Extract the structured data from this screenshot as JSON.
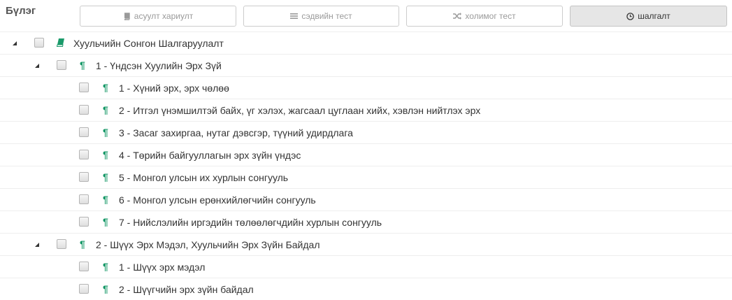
{
  "panel": {
    "title": "Бүлэг"
  },
  "modes": [
    {
      "label": "асуулт хариулт",
      "icon": "book-icon",
      "active": false
    },
    {
      "label": "сэдвийн тест",
      "icon": "list-icon",
      "active": false
    },
    {
      "label": "холимог тест",
      "icon": "shuffle-icon",
      "active": false
    },
    {
      "label": "шалгалт",
      "icon": "clock-icon",
      "active": true
    }
  ],
  "tree": {
    "root": {
      "label": "Хуульчийн Сонгон Шалгаруулалт",
      "icon": "book-icon"
    },
    "chapters": [
      {
        "label": "1 - Үндсэн Хуулийн Эрх Зүй",
        "icon": "paragraph-icon",
        "sections": [
          {
            "label": "1 - Хүний эрх, эрх чөлөө"
          },
          {
            "label": "2 - Итгэл үнэмшилтэй байх, үг хэлэх, жагсаал цуглаан хийх, хэвлэн нийтлэх эрх"
          },
          {
            "label": "3 - Засаг захиргаа, нутаг дэвсгэр, түүний удирдлага"
          },
          {
            "label": "4 - Төрийн байгууллагын эрх зүйн үндэс"
          },
          {
            "label": "5 - Монгол улсын их хурлын сонгууль"
          },
          {
            "label": "6 - Монгол улсын ерөнхийлөгчийн сонгууль"
          },
          {
            "label": "7 - Нийслэлийн иргэдийн төлөөлөгчдийн хурлын сонгууль"
          }
        ]
      },
      {
        "label": "2 - Шүүх Эрх Мэдэл, Хуульчийн Эрх Зүйн Байдал",
        "icon": "paragraph-icon",
        "sections": [
          {
            "label": "1 - Шүүх эрх мэдэл"
          },
          {
            "label": "2 - Шүүгчийн эрх зүйн байдал"
          }
        ]
      }
    ],
    "paragraph_glyph": "¶",
    "accent_color": "#1a9a6a"
  }
}
